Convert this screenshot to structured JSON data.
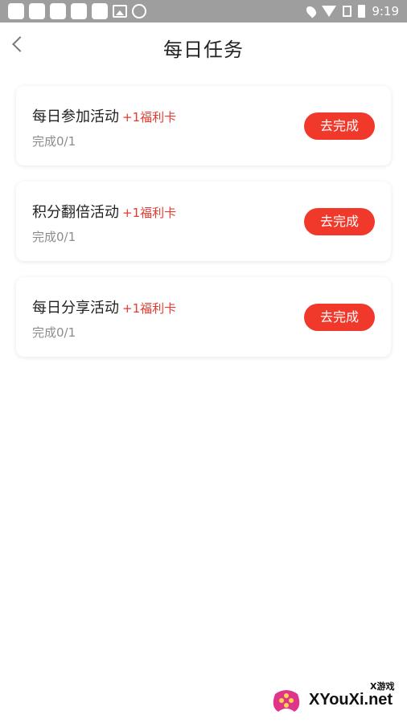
{
  "status_bar": {
    "time": "9:19"
  },
  "header": {
    "title": "每日任务"
  },
  "tasks": [
    {
      "title": "每日参加活动",
      "reward": "+1福利卡",
      "progress": "完成0/1",
      "button": "去完成"
    },
    {
      "title": "积分翻倍活动",
      "reward": "+1福利卡",
      "progress": "完成0/1",
      "button": "去完成"
    },
    {
      "title": "每日分享活动",
      "reward": "+1福利卡",
      "progress": "完成0/1",
      "button": "去完成"
    }
  ],
  "watermark": {
    "text": "XYouXi.net",
    "sub": "X游戏"
  },
  "colors": {
    "accent": "#f0382b",
    "reward": "#e43a2f",
    "muted": "#8c8c8c"
  }
}
